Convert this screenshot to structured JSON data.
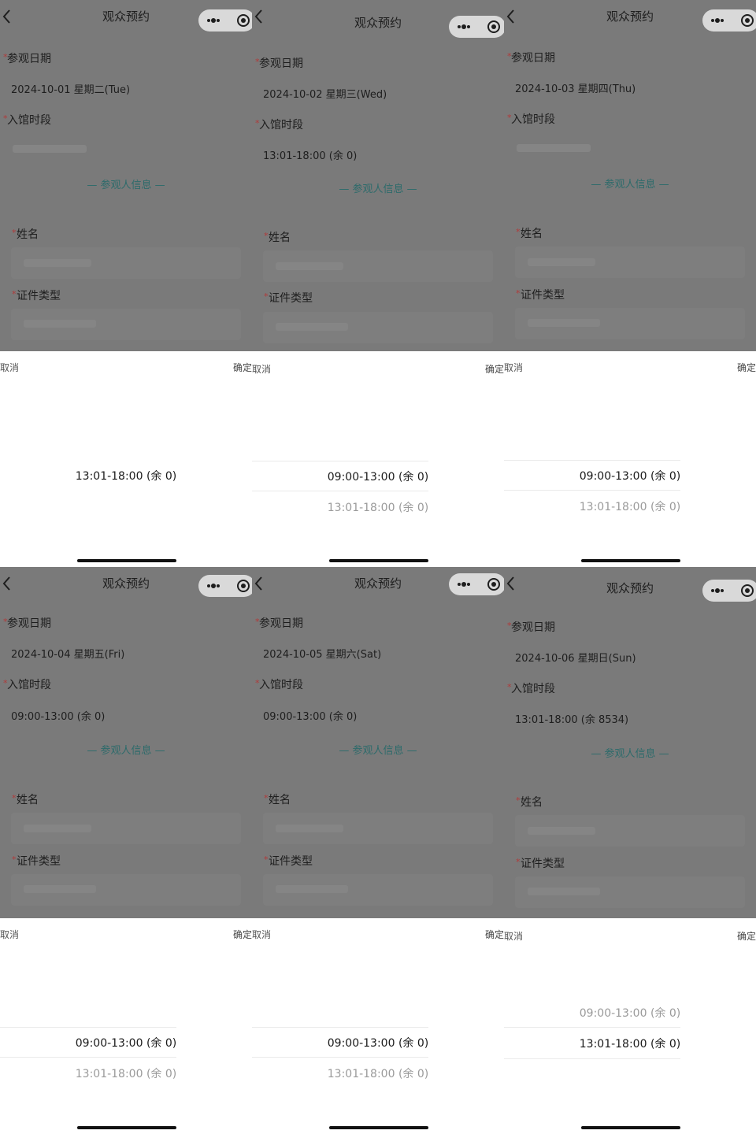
{
  "common": {
    "title": "观众预约",
    "date_label": "参观日期",
    "time_label": "入馆时段",
    "section": "— 参观人信息 —",
    "name_label": "姓名",
    "id_type_label": "证件类型",
    "required_mark": "*",
    "cancel": "取消",
    "confirm": "确定"
  },
  "screens": [
    {
      "date": "2024-10-01 星期二(Tue)",
      "time_value": "",
      "options": [
        {
          "text": "13:01-18:00 (余 0)",
          "state": "selected"
        }
      ]
    },
    {
      "date": "2024-10-02 星期三(Wed)",
      "time_value": "13:01-18:00 (余 0)",
      "options": [
        {
          "text": "09:00-13:00 (余 0)",
          "state": "selected"
        },
        {
          "text": "13:01-18:00 (余 0)",
          "state": "dim"
        }
      ]
    },
    {
      "date": "2024-10-03 星期四(Thu)",
      "time_value": "",
      "options": [
        {
          "text": "09:00-13:00 (余 0)",
          "state": "selected"
        },
        {
          "text": "13:01-18:00 (余 0)",
          "state": "dim"
        }
      ]
    },
    {
      "date": "2024-10-04 星期五(Fri)",
      "time_value": "09:00-13:00 (余 0)",
      "options": [
        {
          "text": "09:00-13:00 (余 0)",
          "state": "selected"
        },
        {
          "text": "13:01-18:00 (余 0)",
          "state": "dim"
        }
      ]
    },
    {
      "date": "2024-10-05 星期六(Sat)",
      "time_value": "09:00-13:00 (余 0)",
      "options": [
        {
          "text": "09:00-13:00 (余 0)",
          "state": "selected"
        },
        {
          "text": "13:01-18:00 (余 0)",
          "state": "dim"
        }
      ]
    },
    {
      "date": "2024-10-06 星期日(Sun)",
      "time_value": "13:01-18:00 (余 8534)",
      "options": [
        {
          "text": "09:00-13:00 (余 0)",
          "state": "dim"
        },
        {
          "text": "13:01-18:00 (余 0)",
          "state": "selected"
        }
      ]
    }
  ]
}
